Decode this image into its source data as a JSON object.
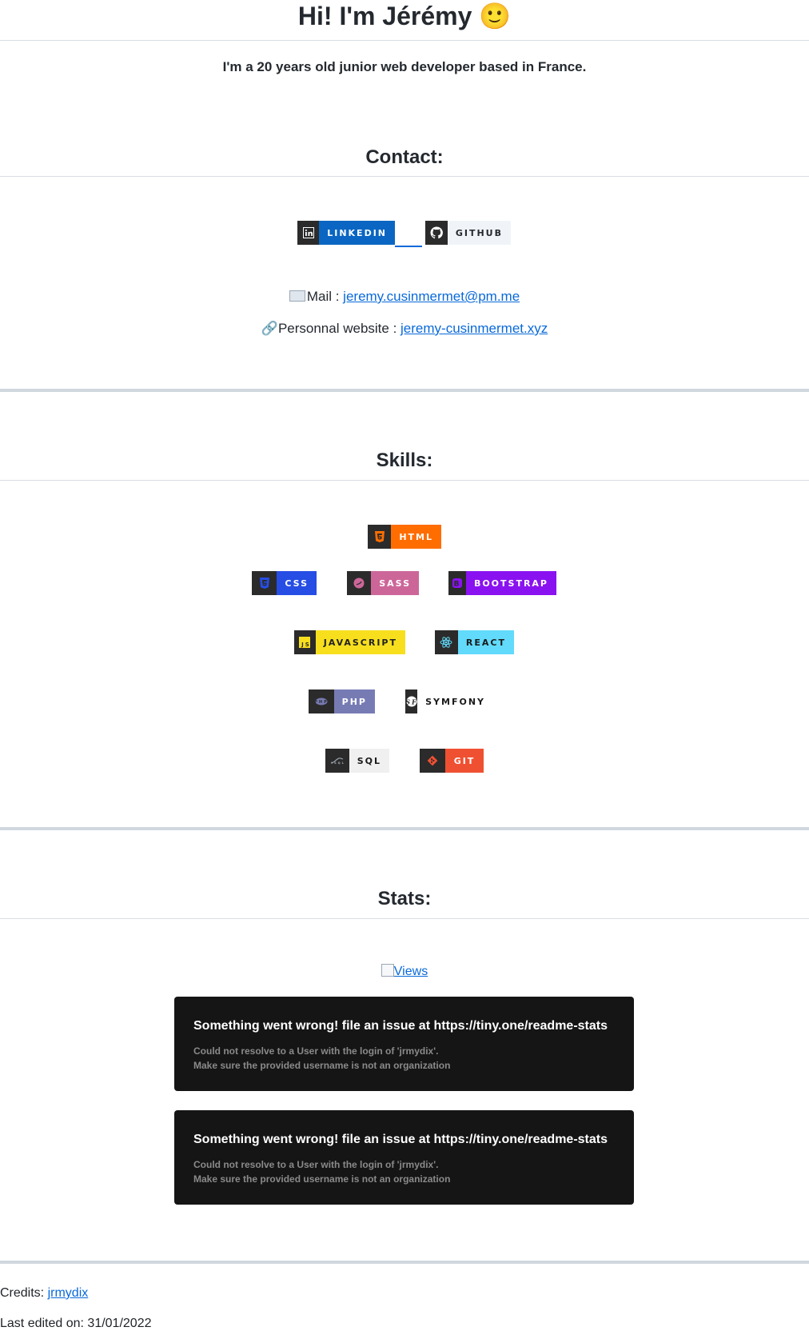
{
  "header": {
    "title": "Hi! I'm Jérémy",
    "emoji": "🙂",
    "intro": "I'm a 20 years old junior web developer based in France."
  },
  "contact": {
    "heading": "Contact:",
    "badges": [
      {
        "label": "LINKEDIN",
        "bg": "#0a66c2",
        "fg": "#ffffff",
        "icon": "linkedin-icon"
      },
      {
        "label": "GITHUB",
        "bg": "#f0f4f8",
        "fg": "#24292f",
        "icon": "github-icon"
      }
    ],
    "mail_label": "Mail : ",
    "mail_value": "jeremy.cusinmermet@pm.me",
    "website_label": "Personnal website : ",
    "website_value": "jeremy-cusinmermet.xyz"
  },
  "skills": {
    "heading": "Skills:",
    "badges": [
      {
        "label": "HTML",
        "bg": "#ff6d00",
        "fg": "#ffffff",
        "icon": "html5-icon"
      },
      {
        "label": "CSS",
        "bg": "#264de4",
        "fg": "#ffffff",
        "icon": "css3-icon"
      },
      {
        "label": "SASS",
        "bg": "#cc6699",
        "fg": "#ffffff",
        "icon": "sass-icon"
      },
      {
        "label": "BOOTSTRAP",
        "bg": "#8a12f0",
        "fg": "#ffffff",
        "icon": "bootstrap-icon"
      },
      {
        "label": "JAVASCRIPT",
        "bg": "#f7df1e",
        "fg": "#222222",
        "icon": "javascript-icon"
      },
      {
        "label": "REACT",
        "bg": "#61dafb",
        "fg": "#1a1a1a",
        "icon": "react-icon"
      },
      {
        "label": "PHP",
        "bg": "#777bb4",
        "fg": "#ffffff",
        "icon": "php-icon"
      },
      {
        "label": "SYMFONY",
        "bg": "#ffffff",
        "fg": "#1a1a1a",
        "icon": "symfony-icon"
      },
      {
        "label": "SQL",
        "bg": "#f0f0f0",
        "fg": "#1a1a1a",
        "icon": "mysql-icon"
      },
      {
        "label": "GIT",
        "bg": "#f05032",
        "fg": "#ffffff",
        "icon": "git-icon"
      }
    ]
  },
  "stats": {
    "heading": "Stats:",
    "views_alt": "Views",
    "errors": [
      {
        "title": "Something went wrong! file an issue at https://tiny.one/readme-stats",
        "line1": "Could not resolve to a User with the login of 'jrmydix'.",
        "line2": "Make sure the provided username is not an organization"
      },
      {
        "title": "Something went wrong! file an issue at https://tiny.one/readme-stats",
        "line1": "Could not resolve to a User with the login of 'jrmydix'.",
        "line2": "Make sure the provided username is not an organization"
      }
    ]
  },
  "footer": {
    "credits_label": "Credits: ",
    "credits_link": "jrmydix",
    "last_edited": "Last edited on: 31/01/2022"
  }
}
